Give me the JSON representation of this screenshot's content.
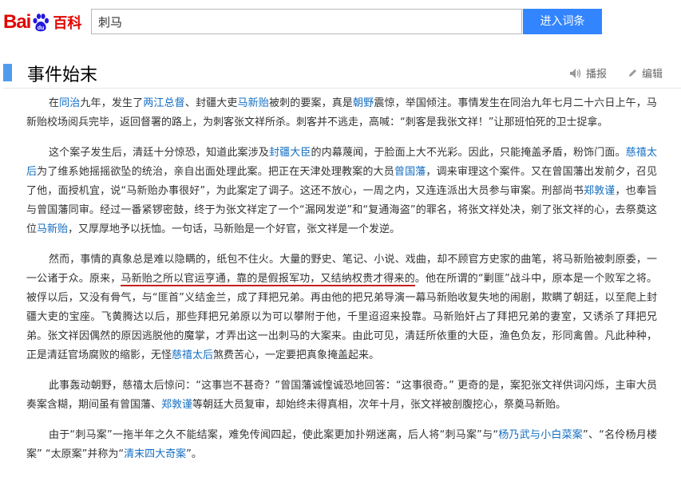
{
  "header": {
    "logo_bai": "Bai",
    "logo_du": "du",
    "logo_baike": "百科",
    "search_value": "刺马",
    "enter_button": "进入词条"
  },
  "section": {
    "title": "事件始末",
    "audio_label": "播报",
    "edit_label": "编辑"
  },
  "paragraphs": {
    "p1": {
      "s1": "在",
      "l1": "同治",
      "s2": "九年，发生了",
      "l2": "两江总督",
      "s3": "、封疆大吏",
      "l3": "马新贻",
      "s4": "被刺的要案，真是",
      "l4": "朝野",
      "s5": "震惊，举国倾注。事情发生在同治九年七月二十六日上午，马新贻校场阅兵完毕，返回督署的路上，为刺客张文祥所杀。刺客并不逃走，高喊：“刺客是我张文祥！”让那班怕死的卫士捉拿。"
    },
    "p2": {
      "s1": "这个案子发生后，清廷十分惊恐，知道此案涉及",
      "l1": "封疆大臣",
      "s2": "的内幕蔑闻，于脸面上大不光彩。因此，只能掩盖矛盾，粉饰门面。",
      "l2": "慈禧太后",
      "s3": "为了维系她摇摇欲坠的统治，亲自出面处理此案。把正在天津处理教案的大员",
      "l3": "曾国藩",
      "s4": "，调来审理这个案件。又在曾国藩出发前夕，召见了他，面授机宜，说“马新贻办事很好”，为此案定了调子。这还不放心，一周之内，又连连派出大员参与审案。刑部尚书",
      "l4": "郑敦谨",
      "s5": "，也奉旨与曾国藩同审。经过一番紧锣密鼓，终于为张文祥定了一个“漏网发逆”和“复通海盗”的罪名，将张文祥处决，剜了张文祥的心，去祭奠这位",
      "l5": "马新贻",
      "s6": "，又厚厚地予以抚恤。一句话，马新贻是一个好官，张文祥是一个发逆。"
    },
    "p3": {
      "s1": "然而，事情的真象总是难以隐瞒的，纸包不住火。大量的野史、笔记、小说、戏曲，却不顾官方史家的曲笔，将马新贻被刺原委，一一公诸于众。原来，",
      "u1": "马新贻之所以官运亨通，靠的是假报军功，又结纳权贵才得来的",
      "s2": "。他在所谓的“剿匪”战斗中，原本是一个败军之将。被俘以后，又没有骨气，与“匪首”义结金兰，成了拜把兄弟。再由他的把兄弟导演一幕马新贻收复失地的闹剧，欺瞒了朝廷，以至爬上封疆大吏的宝座。飞黄腾达以后，那些拜把兄弟原以为可以攀附于他，千里迢迢来投靠。马新贻奸占了拜把兄弟的妻室，又诱杀了拜把兄弟。张文祥因偶然的原因逃脱他的魔掌，才弄出这一出刺马的大案来。由此可见，清廷所依重的大臣，渔色负友，形同禽兽。凡此种种，正是清廷官场腐败的缩影，无怪",
      "l1": "慈禧太后",
      "s3": "煞费苦心，一定要把真象掩盖起来。"
    },
    "p4": {
      "s1": "此事轰动朝野，慈禧太后惊问：“这事岂不甚奇？”曾国藩诚惶诚恐地回答：“这事很奇。” 更奇的是，案犯张文祥供词闪烁，主审大员奏案含糊，期间虽有曾国藩、",
      "l1": "郑敦谨",
      "s2": "等朝廷大员复审，却始终未得真相，次年十月，张文祥被剖腹挖心，祭奠马新贻。"
    },
    "p5": {
      "s1": "由于“刺马案”一拖半年之久不能结案，难免传闻四起，使此案更加扑朔迷离，后人将“刺马案”与“",
      "l1": "杨乃武与小白菜案",
      "s2": "”、“名伶杨月楼案” “太原案”并称为“",
      "l2": "清末四大奇案",
      "s3": "”。"
    }
  },
  "colors": {
    "brand_red": "#e10602",
    "brand_blue": "#2319dc",
    "button_blue": "#3385ff",
    "link": "#136ec2",
    "section_bar": "#4f9cee",
    "underline": "#c62020"
  }
}
